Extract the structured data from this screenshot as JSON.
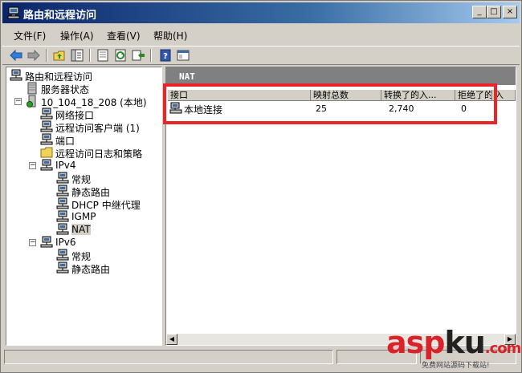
{
  "window": {
    "title": "路由和远程访问",
    "controls": {
      "minimize": "_",
      "maximize": "□",
      "close": "×"
    }
  },
  "menubar": {
    "items": [
      {
        "label": "文件(F)"
      },
      {
        "label": "操作(A)"
      },
      {
        "label": "查看(V)"
      },
      {
        "label": "帮助(H)"
      }
    ]
  },
  "toolbar": {
    "buttons": [
      "back-arrow-icon",
      "forward-arrow-icon",
      "up-folder-icon",
      "show-tree-icon",
      "properties-icon",
      "refresh-icon",
      "export-list-icon",
      "help-icon",
      "console-icon"
    ]
  },
  "tree": {
    "root": "路由和远程访问",
    "server_status": "服务器状态",
    "server": "10_104_18_208 (本地)",
    "network_interfaces": "网络接口",
    "remote_clients": "远程访问客户端 (1)",
    "ports": "端口",
    "logging_policy": "远程访问日志和策略",
    "ipv4": "IPv4",
    "ipv4_general": "常规",
    "ipv4_static_routes": "静态路由",
    "dhcp_relay": "DHCP 中继代理",
    "igmp": "IGMP",
    "nat": "NAT",
    "ipv6": "IPv6",
    "ipv6_general": "常规",
    "ipv6_static_routes": "静态路由",
    "expander_minus": "−"
  },
  "right_pane": {
    "header": "NAT",
    "columns": [
      "接口",
      "映射总数",
      "转换了的入...",
      "拒绝了的",
      "入"
    ],
    "rows": [
      {
        "interface": "本地连接",
        "total_mappings": "25",
        "inbound_translated": "2,740",
        "rejected": "0"
      }
    ]
  },
  "scrollbar": {
    "left_arrow": "◀",
    "right_arrow": "▶"
  },
  "watermark": {
    "brand_a": "asp",
    "brand_b": "ku",
    "brand_c": ".com",
    "subtitle": "免费网站源码下载站!"
  },
  "colors": {
    "title_active": "#0a246a",
    "highlight": "#e8262a",
    "pane_header": "#808080"
  }
}
